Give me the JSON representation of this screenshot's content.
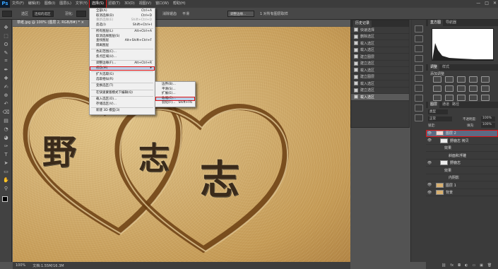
{
  "app": {
    "logo": "Ps"
  },
  "menubar": {
    "items": [
      "文件(F)",
      "编辑(E)",
      "图像(I)",
      "图层(L)",
      "文字(Y)",
      "选择(S)",
      "滤镜(T)",
      "3D(D)",
      "视图(V)",
      "窗口(W)",
      "帮助(H)"
    ],
    "active_index": 5
  },
  "options": {
    "mode_label": "选区",
    "mode_value": "连续的选区",
    "feather_label": "羽化:",
    "antialias": "消除锯齿",
    "smooth_label": "平滑",
    "refine": "调整边缘...",
    "extra": "1 对所有图层取样"
  },
  "document": {
    "tab_title": "草纸.jpg @ 100% (图层 2, RGB/8#) *",
    "close": "×"
  },
  "status": {
    "zoom": "100%",
    "doc": "文档:1.55M/16.3M"
  },
  "canvas": {
    "char_ye": "野",
    "char_zhi": "志",
    "char_zhi2": "志"
  },
  "select_menu": {
    "items": [
      {
        "label": "全部(A)",
        "sc": "Ctrl+A"
      },
      {
        "label": "取消选择(D)",
        "sc": "Ctrl+D"
      },
      {
        "label": "重新选择(E)",
        "sc": "Shift+Ctrl+D",
        "dis": true
      },
      {
        "label": "反选(I)",
        "sc": "Shift+Ctrl+I"
      },
      {
        "sep": true
      },
      {
        "label": "所有图层(L)",
        "sc": "Alt+Ctrl+A"
      },
      {
        "label": "取消选择图层(S)",
        "sc": ""
      },
      {
        "label": "查找图层",
        "sc": "Alt+Shift+Ctrl+F"
      },
      {
        "label": "隔离图层",
        "sc": ""
      },
      {
        "sep": true
      },
      {
        "label": "色彩范围(C)...",
        "sc": ""
      },
      {
        "label": "焦点区域(U)...",
        "sc": ""
      },
      {
        "sep": true
      },
      {
        "label": "调整边缘(F)...",
        "sc": "Alt+Ctrl+R"
      },
      {
        "label": "修改(M)",
        "sc": "",
        "hl": true,
        "sub": true
      },
      {
        "sep": true
      },
      {
        "label": "扩大选取(G)",
        "sc": ""
      },
      {
        "label": "选取相似(R)",
        "sc": ""
      },
      {
        "sep": true
      },
      {
        "label": "变换选区(T)",
        "sc": ""
      },
      {
        "sep": true
      },
      {
        "label": "在快速蒙版模式下编辑(Q)",
        "sc": ""
      },
      {
        "sep": true
      },
      {
        "label": "载入选区(O)...",
        "sc": ""
      },
      {
        "label": "存储选区(V)...",
        "sc": ""
      },
      {
        "sep": true
      },
      {
        "label": "新建 3D 模型(3)",
        "sc": ""
      }
    ]
  },
  "modify_menu": {
    "items": [
      {
        "label": "边界(B)...",
        "sc": ""
      },
      {
        "label": "平滑(S)...",
        "sc": ""
      },
      {
        "label": "扩展(E)...",
        "sc": ""
      },
      {
        "label": "收缩(C)...",
        "sc": "",
        "hl": true
      },
      {
        "label": "羽化(F)...",
        "sc": "Shift+F6"
      }
    ]
  },
  "history": {
    "tab": "历史记录",
    "items": [
      "快速选择",
      "删除选区",
      "载入选区",
      "载入选区",
      "建立图层",
      "建立选区",
      "载入选区",
      "建立图层",
      "载入选区",
      "建立选区",
      "载入选区"
    ],
    "selected_index": 10
  },
  "right": {
    "tabs1": [
      "直方图",
      "导航器"
    ],
    "adj_tabs": [
      "调整",
      "样式"
    ],
    "adj_title": "添加调整",
    "layer_tabs": [
      "图层",
      "通道",
      "路径"
    ],
    "filter_kind": "类型",
    "blend": "正常",
    "opacity_label": "不透明度:",
    "opacity": "100%",
    "lock_label": "锁定:",
    "fill_label": "填充:",
    "fill": "100%"
  },
  "layers": [
    {
      "name": "图层 2",
      "indent": 0,
      "sel": true,
      "thumb": "#f4d8d8"
    },
    {
      "name": "野鹿志 拷贝",
      "indent": 1,
      "thumb": "#eeeeee"
    },
    {
      "name": "效果",
      "indent": 2
    },
    {
      "name": "斜面和浮雕",
      "indent": 3
    },
    {
      "name": "野鹿志",
      "indent": 1,
      "thumb": "#eeeeee"
    },
    {
      "name": "效果",
      "indent": 2
    },
    {
      "name": "内阴影",
      "indent": 3
    },
    {
      "name": "图层 1",
      "indent": 0,
      "thumb": "#d8b070"
    },
    {
      "name": "背景",
      "indent": 0,
      "thumb": "#d8b070"
    }
  ]
}
